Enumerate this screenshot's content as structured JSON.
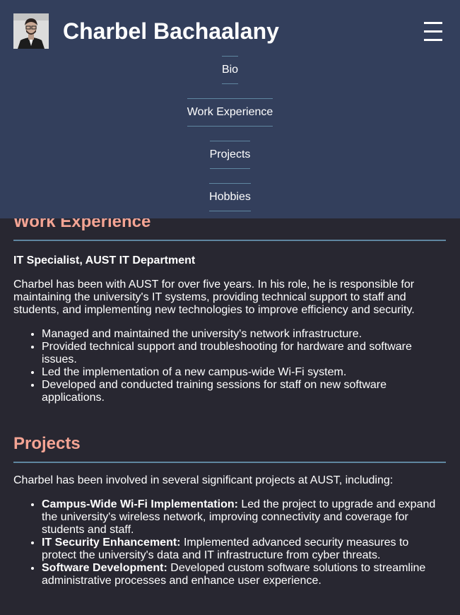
{
  "header": {
    "title": "Charbel Bachaalany",
    "menu_icon": "hamburger-icon"
  },
  "nav": {
    "items": [
      {
        "label": "Bio"
      },
      {
        "label": "Work Experience"
      },
      {
        "label": "Projects"
      },
      {
        "label": "Hobbies"
      }
    ]
  },
  "work": {
    "heading": "Work Experience",
    "job_title": "IT Specialist, AUST IT Department",
    "description": "Charbel has been with AUST for over five years. In his role, he is responsible for maintaining the university's IT systems, providing technical support to staff and students, and implementing new technologies to improve efficiency and security.",
    "bullets": [
      "Managed and maintained the university's network infrastructure.",
      "Provided technical support and troubleshooting for hardware and software issues.",
      "Led the implementation of a new campus-wide Wi-Fi system.",
      "Developed and conducted training sessions for staff on new software applications."
    ]
  },
  "projects": {
    "heading": "Projects",
    "intro": "Charbel has been involved in several significant projects at AUST, including:",
    "items": [
      {
        "name": "Campus-Wide Wi-Fi Implementation:",
        "text": " Led the project to upgrade and expand the university's wireless network, improving connectivity and coverage for students and staff."
      },
      {
        "name": "IT Security Enhancement:",
        "text": " Implemented advanced security measures to protect the university's data and IT infrastructure from cyber threats."
      },
      {
        "name": "Software Development:",
        "text": " Developed custom software solutions to streamline administrative processes and enhance user experience."
      }
    ]
  },
  "colors": {
    "header_bg": "#333f5c",
    "page_bg": "#282731",
    "heading_accent": "#f4a494",
    "rule": "#5f86a0"
  }
}
